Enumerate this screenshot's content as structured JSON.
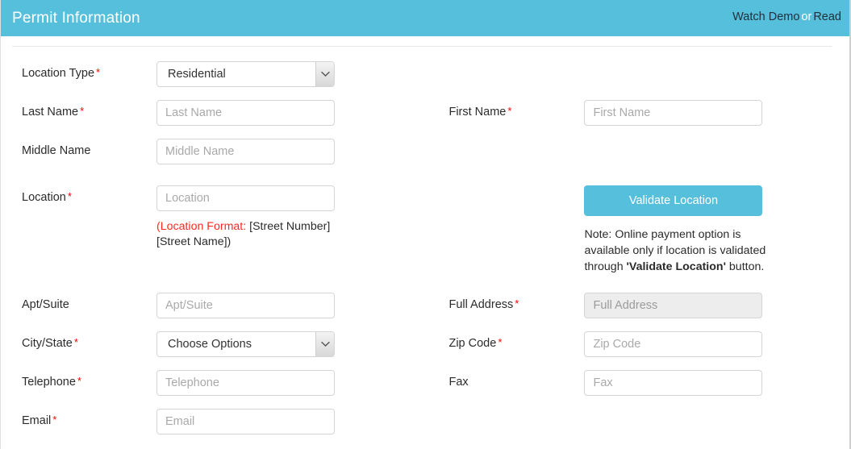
{
  "header": {
    "title": "Permit Information",
    "watch_demo": "Watch Demo",
    "separator": "or",
    "read": "Read"
  },
  "form": {
    "location_type": {
      "label": "Location Type",
      "required": true,
      "value": "Residential",
      "options": [
        "Residential"
      ]
    },
    "last_name": {
      "label": "Last Name",
      "required": true,
      "placeholder": "Last Name",
      "value": ""
    },
    "first_name": {
      "label": "First Name",
      "required": true,
      "placeholder": "First Name",
      "value": ""
    },
    "middle_name": {
      "label": "Middle Name",
      "required": false,
      "placeholder": "Middle Name",
      "value": ""
    },
    "location": {
      "label": "Location",
      "required": true,
      "placeholder": "Location",
      "value": "",
      "hint_red": "(Location Format:",
      "hint_rest": " [Street Number] [Street Name])"
    },
    "validate_location": {
      "button_label": "Validate Location",
      "note_pre": "Note: Online payment option is available only if location is validated through ",
      "note_bold": "'Validate Location'",
      "note_post": " button."
    },
    "apt_suite": {
      "label": "Apt/Suite",
      "required": false,
      "placeholder": "Apt/Suite",
      "value": ""
    },
    "full_address": {
      "label": "Full Address",
      "required": true,
      "placeholder": "Full Address",
      "value": "",
      "disabled": true
    },
    "city_state": {
      "label": "City/State",
      "required": true,
      "value": "Choose Options",
      "options": [
        "Choose Options"
      ]
    },
    "zip_code": {
      "label": "Zip Code",
      "required": true,
      "placeholder": "Zip Code",
      "value": ""
    },
    "telephone": {
      "label": "Telephone",
      "required": true,
      "placeholder": "Telephone",
      "value": ""
    },
    "fax": {
      "label": "Fax",
      "required": false,
      "placeholder": "Fax",
      "value": ""
    },
    "email": {
      "label": "Email",
      "required": true,
      "placeholder": "Email",
      "value": ""
    }
  },
  "colors": {
    "accent": "#56c0dc",
    "required_marker": "#ff0000",
    "hint_red": "#ff2a1f"
  }
}
